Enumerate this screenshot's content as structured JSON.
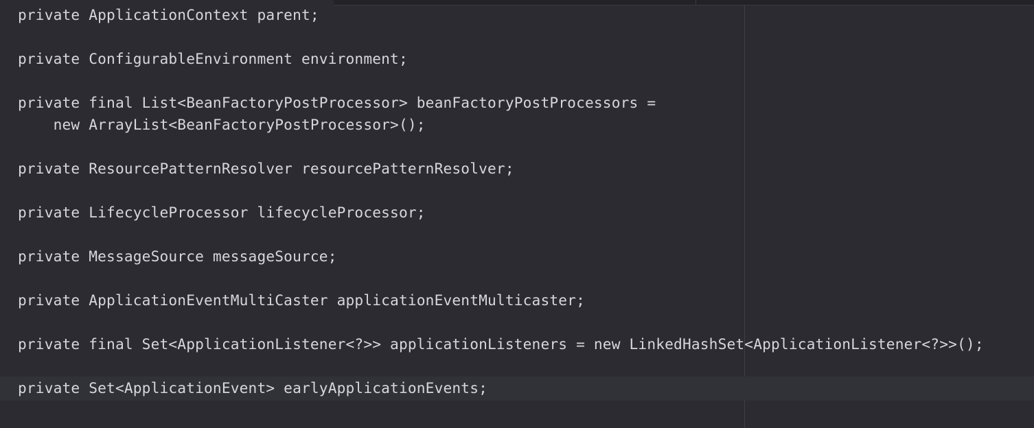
{
  "editor": {
    "lines": [
      "private ApplicationContext parent;",
      "private ConfigurableEnvironment environment;",
      "private final List<BeanFactoryPostProcessor> beanFactoryPostProcessors =",
      "    new ArrayList<BeanFactoryPostProcessor>();",
      "private ResourcePatternResolver resourcePatternResolver;",
      "private LifecycleProcessor lifecycleProcessor;",
      "private MessageSource messageSource;",
      "private ApplicationEventMultiCaster applicationEventMulticaster;",
      "private final Set<ApplicationListener<?>> applicationListeners = new LinkedHashSet<ApplicationListener<?>>();",
      "private Set<ApplicationEvent> earlyApplicationEvents;"
    ],
    "colors": {
      "background": "#2b2b31",
      "text": "#d7d7db",
      "current_line": "#313138",
      "ruler": "#3e3e45"
    }
  }
}
